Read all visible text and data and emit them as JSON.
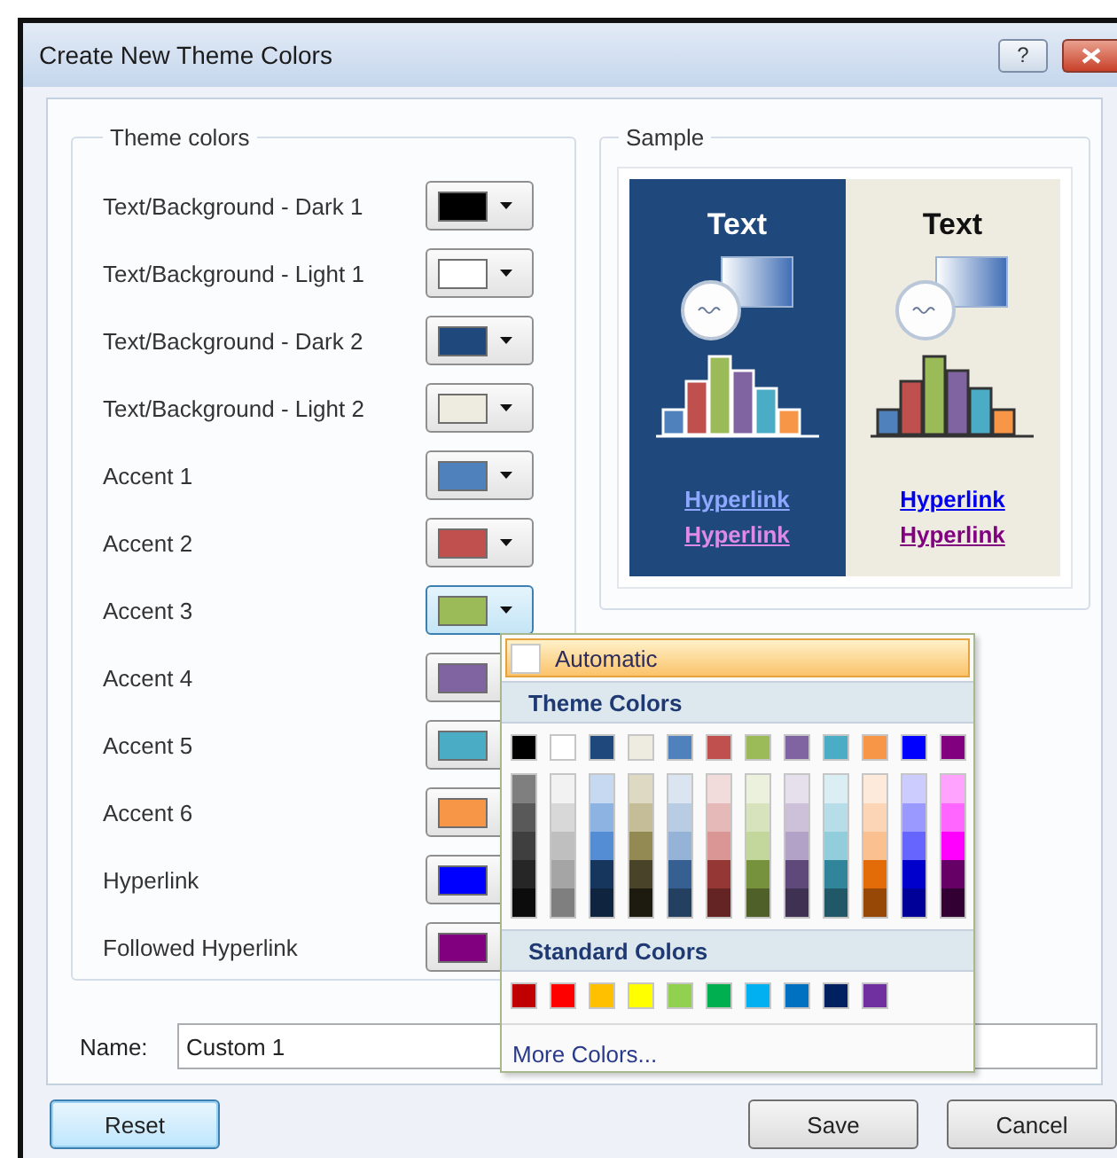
{
  "window": {
    "title": "Create New Theme Colors",
    "help_button": "?"
  },
  "theme_colors": {
    "legend": "Theme colors",
    "rows": [
      {
        "label": "Text/Background - Dark 1",
        "color": "#000000",
        "open": false
      },
      {
        "label": "Text/Background - Light 1",
        "color": "#ffffff",
        "open": false
      },
      {
        "label": "Text/Background - Dark 2",
        "color": "#1f497d",
        "open": false
      },
      {
        "label": "Text/Background - Light 2",
        "color": "#eeece1",
        "open": false
      },
      {
        "label": "Accent 1",
        "color": "#4f81bd",
        "open": false
      },
      {
        "label": "Accent 2",
        "color": "#c0504d",
        "open": false
      },
      {
        "label": "Accent 3",
        "color": "#9bbb59",
        "open": true
      },
      {
        "label": "Accent 4",
        "color": "#8064a2",
        "open": false
      },
      {
        "label": "Accent 5",
        "color": "#4bacc6",
        "open": false
      },
      {
        "label": "Accent 6",
        "color": "#f79646",
        "open": false
      },
      {
        "label": "Hyperlink",
        "color": "#0000ff",
        "open": false
      },
      {
        "label": "Followed Hyperlink",
        "color": "#800080",
        "open": false
      }
    ]
  },
  "sample": {
    "legend": "Sample",
    "panels": [
      {
        "kind": "dark",
        "color": "#1f497d",
        "heading": "Text",
        "links": [
          {
            "text": "Hyperlink",
            "followed": false
          },
          {
            "text": "Hyperlink",
            "followed": true
          }
        ]
      },
      {
        "kind": "light",
        "color": "#eeece1",
        "heading": "Text",
        "links": [
          {
            "text": "Hyperlink",
            "followed": false
          },
          {
            "text": "Hyperlink",
            "followed": true
          }
        ]
      }
    ]
  },
  "color_menu": {
    "automatic": {
      "label": "Automatic",
      "highlighted": true
    },
    "theme_header": "Theme Colors",
    "theme_colors": [
      {
        "color": "#000000",
        "shades": [
          {
            "color": "#7f7f7f"
          },
          {
            "color": "#595959"
          },
          {
            "color": "#3f3f3f"
          },
          {
            "color": "#262626"
          },
          {
            "color": "#0c0c0c"
          }
        ]
      },
      {
        "color": "#ffffff",
        "shades": [
          {
            "color": "#f2f2f2"
          },
          {
            "color": "#d8d8d8"
          },
          {
            "color": "#bfbfbf"
          },
          {
            "color": "#a5a5a5"
          },
          {
            "color": "#7f7f7f"
          }
        ]
      },
      {
        "color": "#1f497d",
        "shades": [
          {
            "color": "#c6d9f0"
          },
          {
            "color": "#8db3e2"
          },
          {
            "color": "#548dd4"
          },
          {
            "color": "#17365d"
          },
          {
            "color": "#0f243e"
          }
        ]
      },
      {
        "color": "#eeece1",
        "shades": [
          {
            "color": "#ddd9c3"
          },
          {
            "color": "#c4bd97"
          },
          {
            "color": "#938953"
          },
          {
            "color": "#494429"
          },
          {
            "color": "#1d1b10"
          }
        ]
      },
      {
        "color": "#4f81bd",
        "shades": [
          {
            "color": "#dbe5f1"
          },
          {
            "color": "#b8cce4"
          },
          {
            "color": "#95b3d7"
          },
          {
            "color": "#366092"
          },
          {
            "color": "#244061"
          }
        ]
      },
      {
        "color": "#c0504d",
        "shades": [
          {
            "color": "#f2dcdb"
          },
          {
            "color": "#e5b9b7"
          },
          {
            "color": "#d99694"
          },
          {
            "color": "#953734"
          },
          {
            "color": "#632423"
          }
        ]
      },
      {
        "color": "#9bbb59",
        "shades": [
          {
            "color": "#ebf1dd"
          },
          {
            "color": "#d7e3bc"
          },
          {
            "color": "#c3d69b"
          },
          {
            "color": "#76923c"
          },
          {
            "color": "#4f6128"
          }
        ]
      },
      {
        "color": "#8064a2",
        "shades": [
          {
            "color": "#e5e0ec"
          },
          {
            "color": "#ccc1d9"
          },
          {
            "color": "#b2a2c7"
          },
          {
            "color": "#5f497a"
          },
          {
            "color": "#3f3151"
          }
        ]
      },
      {
        "color": "#4bacc6",
        "shades": [
          {
            "color": "#dbeef3"
          },
          {
            "color": "#b7dde8"
          },
          {
            "color": "#92cddc"
          },
          {
            "color": "#31859b"
          },
          {
            "color": "#205867"
          }
        ]
      },
      {
        "color": "#f79646",
        "shades": [
          {
            "color": "#fdeada"
          },
          {
            "color": "#fbd5b5"
          },
          {
            "color": "#fac08f"
          },
          {
            "color": "#e36c09"
          },
          {
            "color": "#974806"
          }
        ]
      },
      {
        "color": "#0000ff",
        "shades": [
          {
            "color": "#ccccff"
          },
          {
            "color": "#9999ff"
          },
          {
            "color": "#6666ff"
          },
          {
            "color": "#0000cc"
          },
          {
            "color": "#000099"
          }
        ]
      },
      {
        "color": "#800080",
        "shades": [
          {
            "color": "#ffa3ff"
          },
          {
            "color": "#ff66ff"
          },
          {
            "color": "#ff00ff"
          },
          {
            "color": "#660066"
          },
          {
            "color": "#330033"
          }
        ]
      }
    ],
    "standard_header": "Standard Colors",
    "standard_colors": [
      {
        "color": "#c00000"
      },
      {
        "color": "#ff0000"
      },
      {
        "color": "#ffc000"
      },
      {
        "color": "#ffff00"
      },
      {
        "color": "#92d050"
      },
      {
        "color": "#00b050"
      },
      {
        "color": "#00b0f0"
      },
      {
        "color": "#0070c0"
      },
      {
        "color": "#002060"
      },
      {
        "color": "#7030a0"
      }
    ],
    "more": "More Colors..."
  },
  "name_field": {
    "label": "Name:",
    "value": "Custom 1"
  },
  "buttons": [
    {
      "label": "Reset",
      "default": true
    },
    {
      "label": "Save",
      "default": false
    },
    {
      "label": "Cancel",
      "default": false
    }
  ]
}
